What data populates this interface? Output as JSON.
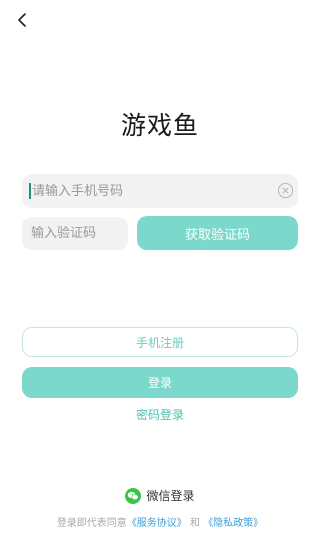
{
  "header": {
    "back_icon": "chevron-left-icon"
  },
  "app_title": "游戏鱼",
  "phone_input": {
    "placeholder": "请输入手机号码",
    "value": "",
    "clear_icon": "clear-circle-icon"
  },
  "code_input": {
    "placeholder": "输入验证码",
    "value": ""
  },
  "get_code_button": "获取验证码",
  "register_button": "手机注册",
  "login_button": "登录",
  "password_login_link": "密码登录",
  "wechat_login": {
    "icon": "wechat-icon",
    "label": "微信登录"
  },
  "agreement": {
    "prefix": "登录即代表同意",
    "service_link": "《服务协议》",
    "joiner": "和",
    "privacy_link": "《隐私政策》"
  },
  "colors": {
    "accent": "#7dd8cc",
    "accent_text": "#4fbfb1",
    "link_blue": "#3e9fd6",
    "wechat_green": "#3dc24a"
  }
}
